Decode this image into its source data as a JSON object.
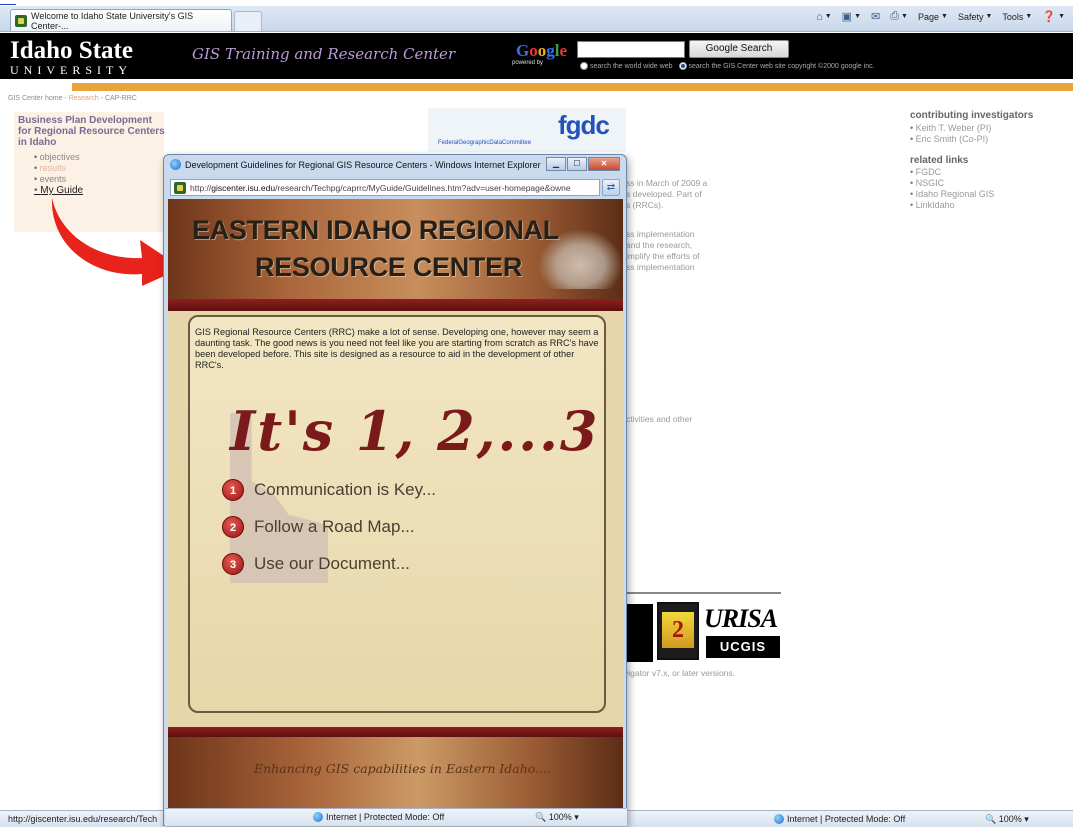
{
  "browser": {
    "tab_title": "Welcome to Idaho State University's GIS Center-...",
    "commands": [
      "Page",
      "Safety",
      "Tools"
    ],
    "status_url": "http://giscenter.isu.edu/research/Tech",
    "status_zone": "Internet | Protected Mode: Off",
    "status_zoom": "100%"
  },
  "header": {
    "logo_line1": "Idaho State",
    "logo_line2": "UNIVERSITY",
    "tagline": "GIS Training and Research Center",
    "google_logo": [
      "G",
      "o",
      "o",
      "g",
      "l",
      "e"
    ],
    "powered_by": "powered by",
    "search_button": "Google Search",
    "radio_1": "search the world wide web",
    "radio_2": "search the GIS Center web site copyright ©2000 google inc."
  },
  "breadcrumb": {
    "home": "GIS Center home",
    "research": "Research",
    "current": "CAP-RRC"
  },
  "sidebar": {
    "title": "Business Plan Development for Regional Resource Centers in Idaho",
    "items": [
      "objectives",
      "results",
      "events",
      "My Guide"
    ]
  },
  "fgdc": {
    "big": "fgdc",
    "small": "FederalGeographicDataCommittee"
  },
  "right_col": {
    "contrib_title": "contributing investigators",
    "contrib": [
      "Keith T. Weber (PI)",
      "Eric Smith (Co-PI)"
    ],
    "related_title": "related links",
    "related": [
      "FGDC",
      "NSGIC",
      "Idaho Regional GIS",
      "LinkIdaho"
    ]
  },
  "body_fragments": {
    "f1": "ss in March of 2009 a",
    "f2": "s developed. Part of",
    "f3": "s (RRCs).",
    "f4": "ss implementation",
    "f5": "and the research,",
    "f6": "implify the efforts of",
    "f7": "ss implementation",
    "f8": "ctivities and other",
    "navtext": "vigator v7.x, or later versions."
  },
  "logos": {
    "internet2": "2",
    "urisa": "URISA",
    "ucgis": "UCGIS"
  },
  "popup": {
    "title": "Development Guidelines for Regional GIS Resource Centers - Windows Internet Explorer",
    "url_prefix": "http://",
    "url_host": "giscenter.isu.edu",
    "url_path": "/research/Techpg/caprrc/MyGuide/Guidelines.htm?adv=user-homepage&owne",
    "banner_line1": "EASTERN IDAHO REGIONAL",
    "banner_line2": "RESOURCE CENTER",
    "intro": "GIS Regional Resource Centers (RRC) make a lot of sense. Developing one, however may seem a daunting task. The good news is you need not feel like you are starting from scratch as RRC's have been developed before. This site is designed as a resource to aid in the development of other RRC's.",
    "big_text": "It's 1, 2,...3",
    "steps": [
      {
        "num": "1",
        "text": "Communication is Key..."
      },
      {
        "num": "2",
        "text": "Follow a Road Map..."
      },
      {
        "num": "3",
        "text": "Use our Document..."
      }
    ],
    "footer_tagline": "Enhancing GIS capabilities in Eastern Idaho....",
    "status_zone": "Internet | Protected Mode: Off",
    "status_zoom": "100%"
  }
}
